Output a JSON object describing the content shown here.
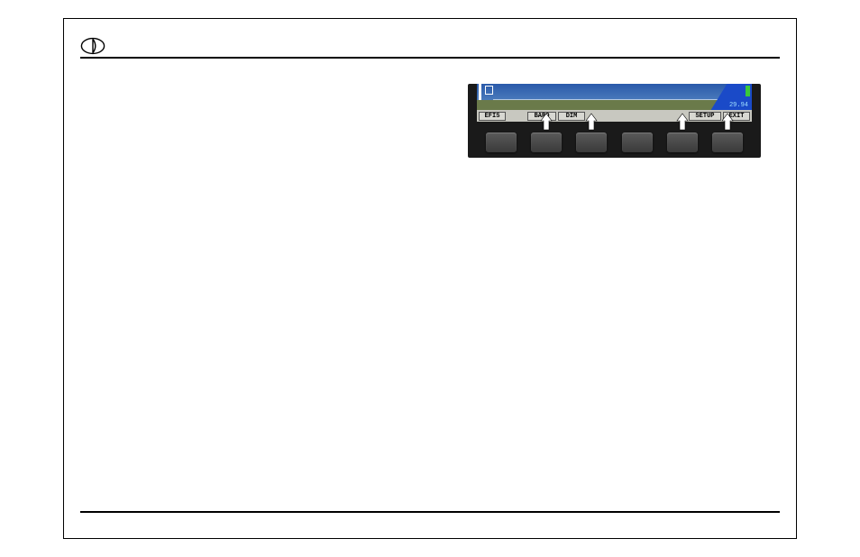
{
  "menu": {
    "tabs": [
      "EFIS",
      "BARO",
      "DIM",
      "SETUP",
      "EXIT"
    ]
  },
  "screen": {
    "reading": "29.94"
  }
}
